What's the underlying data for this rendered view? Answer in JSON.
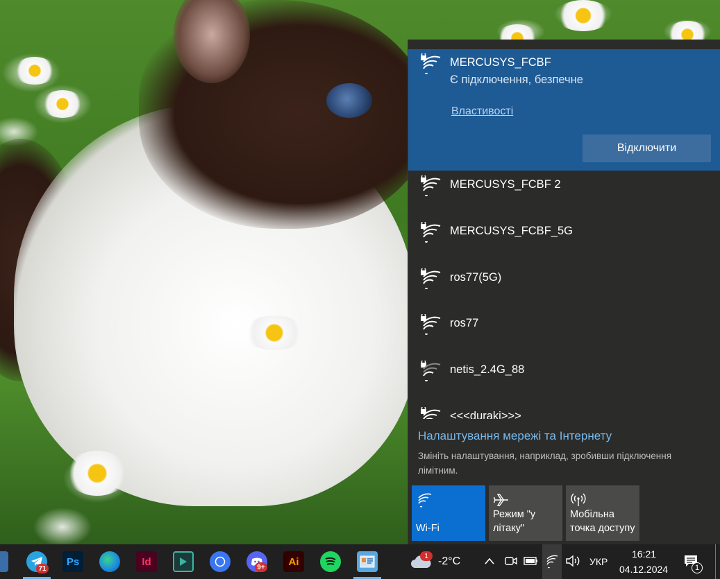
{
  "flyout": {
    "connected": {
      "ssid": "MERCUSYS_FCBF",
      "status": "Є підключення, безпечне",
      "properties_link": "Властивості",
      "disconnect_button": "Відключити"
    },
    "networks": [
      {
        "ssid": "MERCUSYS_FCBF 2",
        "secured": true,
        "icon": "wifi-secured-icon"
      },
      {
        "ssid": "MERCUSYS_FCBF_5G",
        "secured": true,
        "icon": "wifi-secured-icon"
      },
      {
        "ssid": "ros77(5G)",
        "secured": true,
        "icon": "wifi-secured-icon"
      },
      {
        "ssid": "ros77",
        "secured": true,
        "icon": "wifi-secured-icon"
      },
      {
        "ssid": "netis_2.4G_88",
        "secured": true,
        "icon": "wifi-secured-weak-icon"
      },
      {
        "ssid": "<<<duraki>>>",
        "secured": true,
        "icon": "wifi-secured-icon"
      }
    ],
    "settings": {
      "link": "Налаштування мережі та Інтернету",
      "description": "Змініть налаштування, наприклад, зробивши підключення лімітним."
    },
    "quick_actions": [
      {
        "label": "Wi-Fi",
        "active": true,
        "icon": "wifi-icon"
      },
      {
        "label": "Режим \"у літаку\"",
        "active": false,
        "icon": "airplane-icon"
      },
      {
        "label": "Мобільна точка доступу",
        "active": false,
        "icon": "hotspot-icon"
      }
    ]
  },
  "taskbar": {
    "apps": [
      {
        "name": "telegram",
        "badge": "71"
      },
      {
        "name": "photoshop",
        "text": "Ps"
      },
      {
        "name": "edge"
      },
      {
        "name": "indesign",
        "text": "Id"
      },
      {
        "name": "camtasia"
      },
      {
        "name": "signal"
      },
      {
        "name": "discord",
        "badge": "9+"
      },
      {
        "name": "illustrator",
        "text": "Ai"
      },
      {
        "name": "spotify"
      },
      {
        "name": "photos"
      }
    ],
    "weather": {
      "temp": "-2°C",
      "badge": "1"
    },
    "language": "УКР",
    "time": "16:21",
    "date": "04.12.2024",
    "notifications_count": "1"
  },
  "colors": {
    "flyout_bg": "#2b2b29",
    "selected_bg": "#1e5a94",
    "accent": "#0a6fd0",
    "link": "#76b9ed",
    "taskbar_bg": "#202020"
  }
}
